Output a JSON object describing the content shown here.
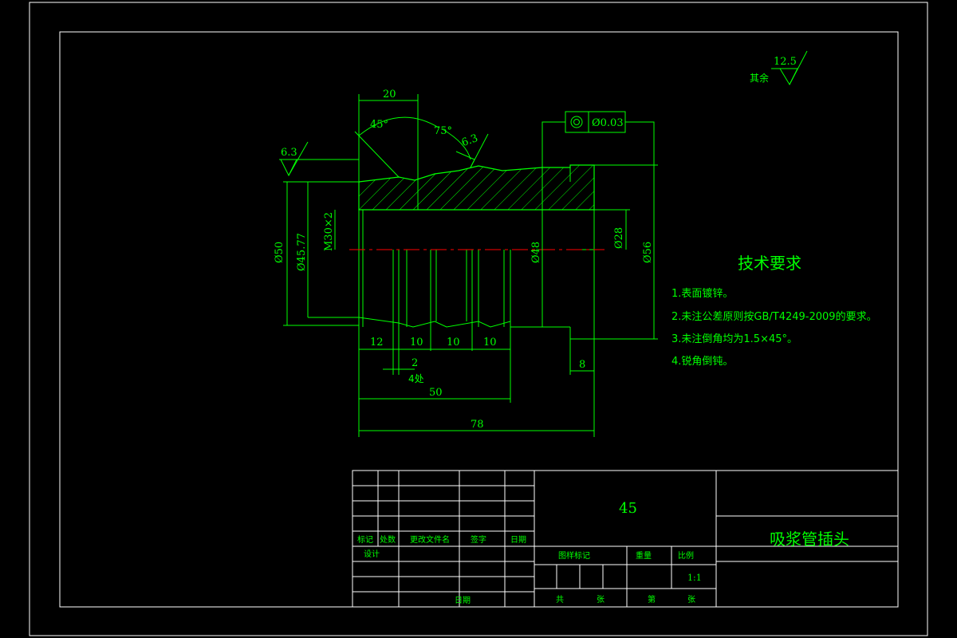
{
  "drawing": {
    "surface_finish_other": {
      "label": "其余",
      "value": "12.5"
    },
    "roughness_left": "6.3",
    "roughness_right": "6.3",
    "angles": {
      "left": "45°",
      "right": "75°"
    },
    "tolerance": {
      "symbol": "◎",
      "value": "Ø0.03"
    },
    "dimensions": {
      "top_20": "20",
      "d50": "Ø50",
      "d45_77": "Ø45.77",
      "thread": "M30×2",
      "d48": "Ø48",
      "d28": "Ø28",
      "d56": "Ø56",
      "w12": "12",
      "w10a": "10",
      "w10b": "10",
      "w10c": "10",
      "groove": "2",
      "groove_count": "4处",
      "len50": "50",
      "len78": "78",
      "len8": "8"
    },
    "tech_requirements": {
      "title": "技术要求",
      "items": [
        "1.表面镀锌。",
        "2.未注公差原则按GB/T4249-2009的要求。",
        "3.未注倒角均为1.5×45°。",
        "4.锐角倒钝。"
      ]
    }
  },
  "title_block": {
    "material": "45",
    "part_name": "吸浆管插头",
    "headers": [
      "标记",
      "处数",
      "更改文件名",
      "签字",
      "日期"
    ],
    "design": "设计",
    "date": "日期",
    "stage_mark": "图样标记",
    "weight": "重量",
    "scale_label": "比例",
    "scale": "1:1",
    "total_sheets": "共",
    "sheets_unit": "张",
    "sheet_no": "第",
    "sheet_unit2": "张"
  },
  "colors": {
    "background": "#000000",
    "geometry": "#00ff00",
    "frame": "#ffffff",
    "centerline": "#ff0000"
  }
}
